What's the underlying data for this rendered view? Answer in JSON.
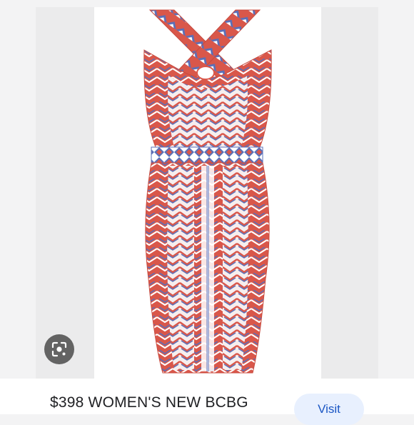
{
  "product": {
    "title": "$398 WOMEN'S NEW BCBG",
    "image_subject": "red-white-blue-patterned-bodycon-dress"
  },
  "actions": {
    "visit_label": "Visit",
    "lens_icon": "google-lens-icon"
  },
  "colors": {
    "accent_bg": "#e8f0fe",
    "accent_text": "#1a56c4",
    "dress_red": "#d9574a",
    "dress_blue": "#5a6fb8"
  }
}
